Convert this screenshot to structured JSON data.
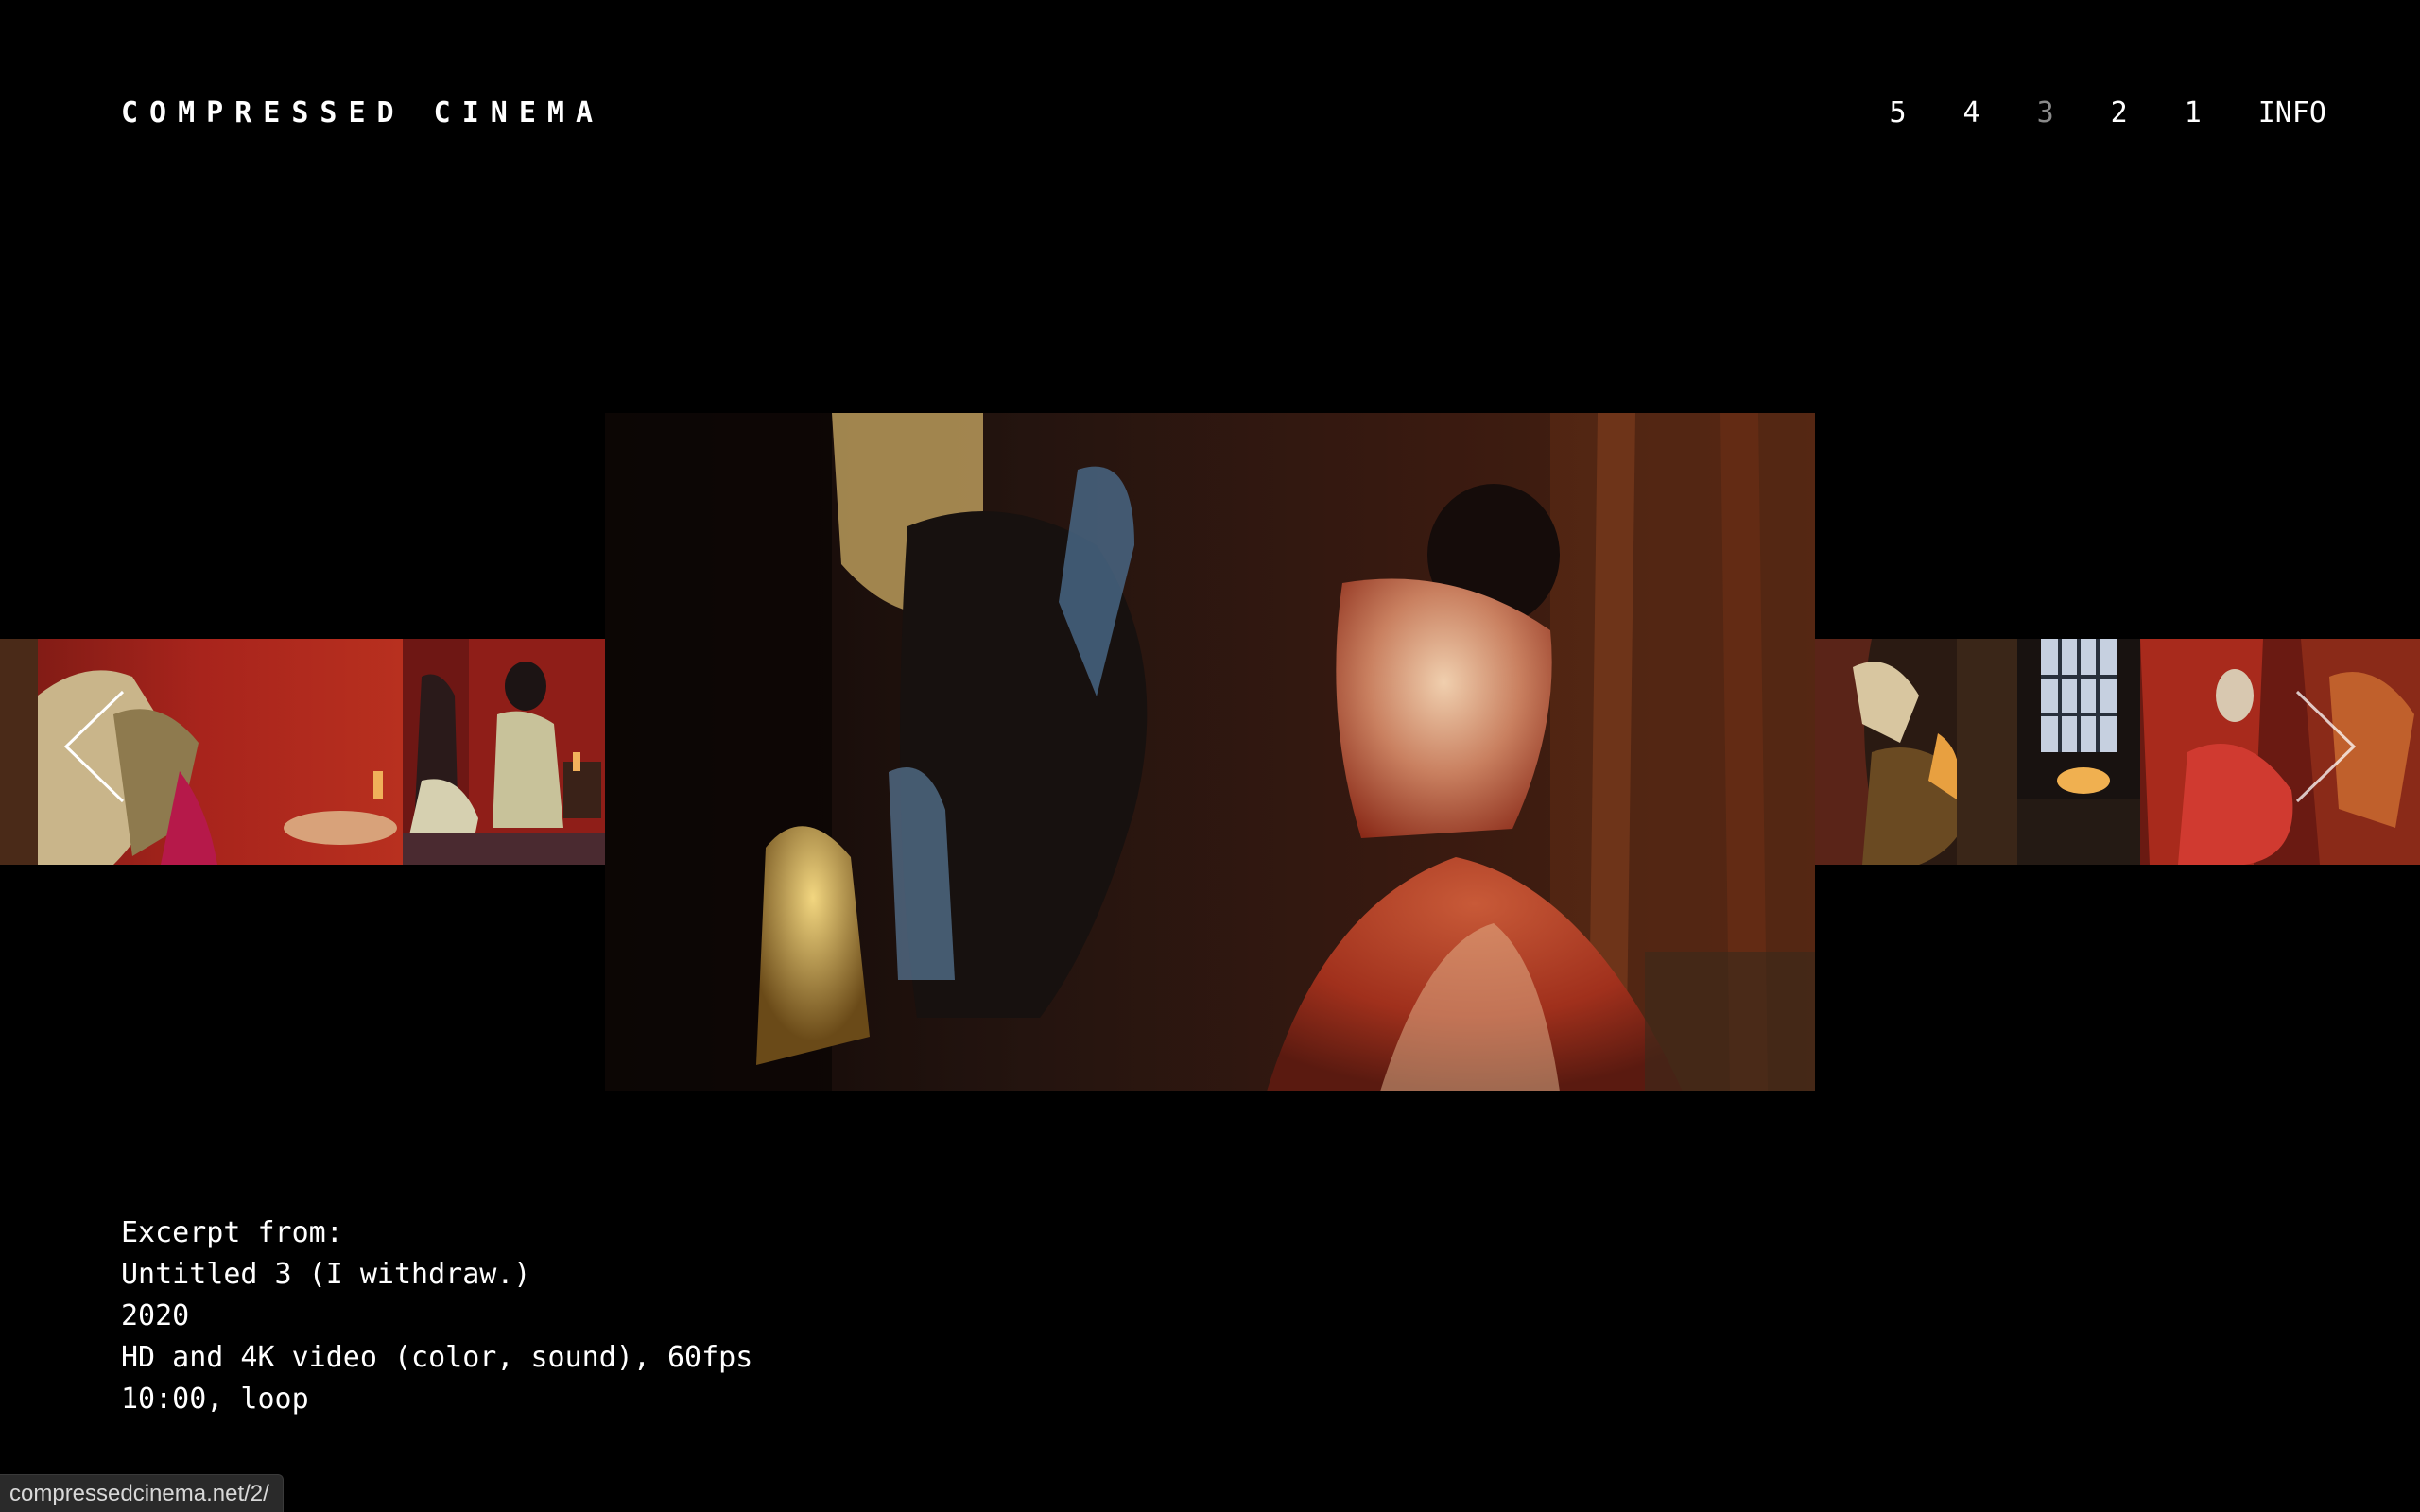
{
  "site": {
    "title": "COMPRESSED CINEMA"
  },
  "nav": {
    "items": [
      {
        "label": "5",
        "active": false
      },
      {
        "label": "4",
        "active": false
      },
      {
        "label": "3",
        "active": true
      },
      {
        "label": "2",
        "active": false
      },
      {
        "label": "1",
        "active": false
      },
      {
        "label": "INFO",
        "active": false
      }
    ]
  },
  "carousel": {
    "prev_icon": "chevron-left-icon",
    "next_icon": "chevron-right-icon",
    "thumbnails_left": [
      "red-room-figure-frame",
      "red-room-seated-figure-frame"
    ],
    "main_frame": "dancing-figures-frame",
    "thumbnails_right": [
      "dark-figure-frame",
      "stained-glass-red-dress-frame"
    ]
  },
  "caption": {
    "line1": "Excerpt from:",
    "line2": "Untitled 3 (I withdraw.)",
    "line3": "2020",
    "line4": "HD and 4K video (color, sound), 60fps",
    "line5": "10:00, loop"
  },
  "status": {
    "url": "compressedcinema.net/2/"
  },
  "colors": {
    "background": "#000000",
    "text": "#ffffff",
    "active_nav": "#8a8a8a",
    "status_bg": "#2a2a2a"
  }
}
